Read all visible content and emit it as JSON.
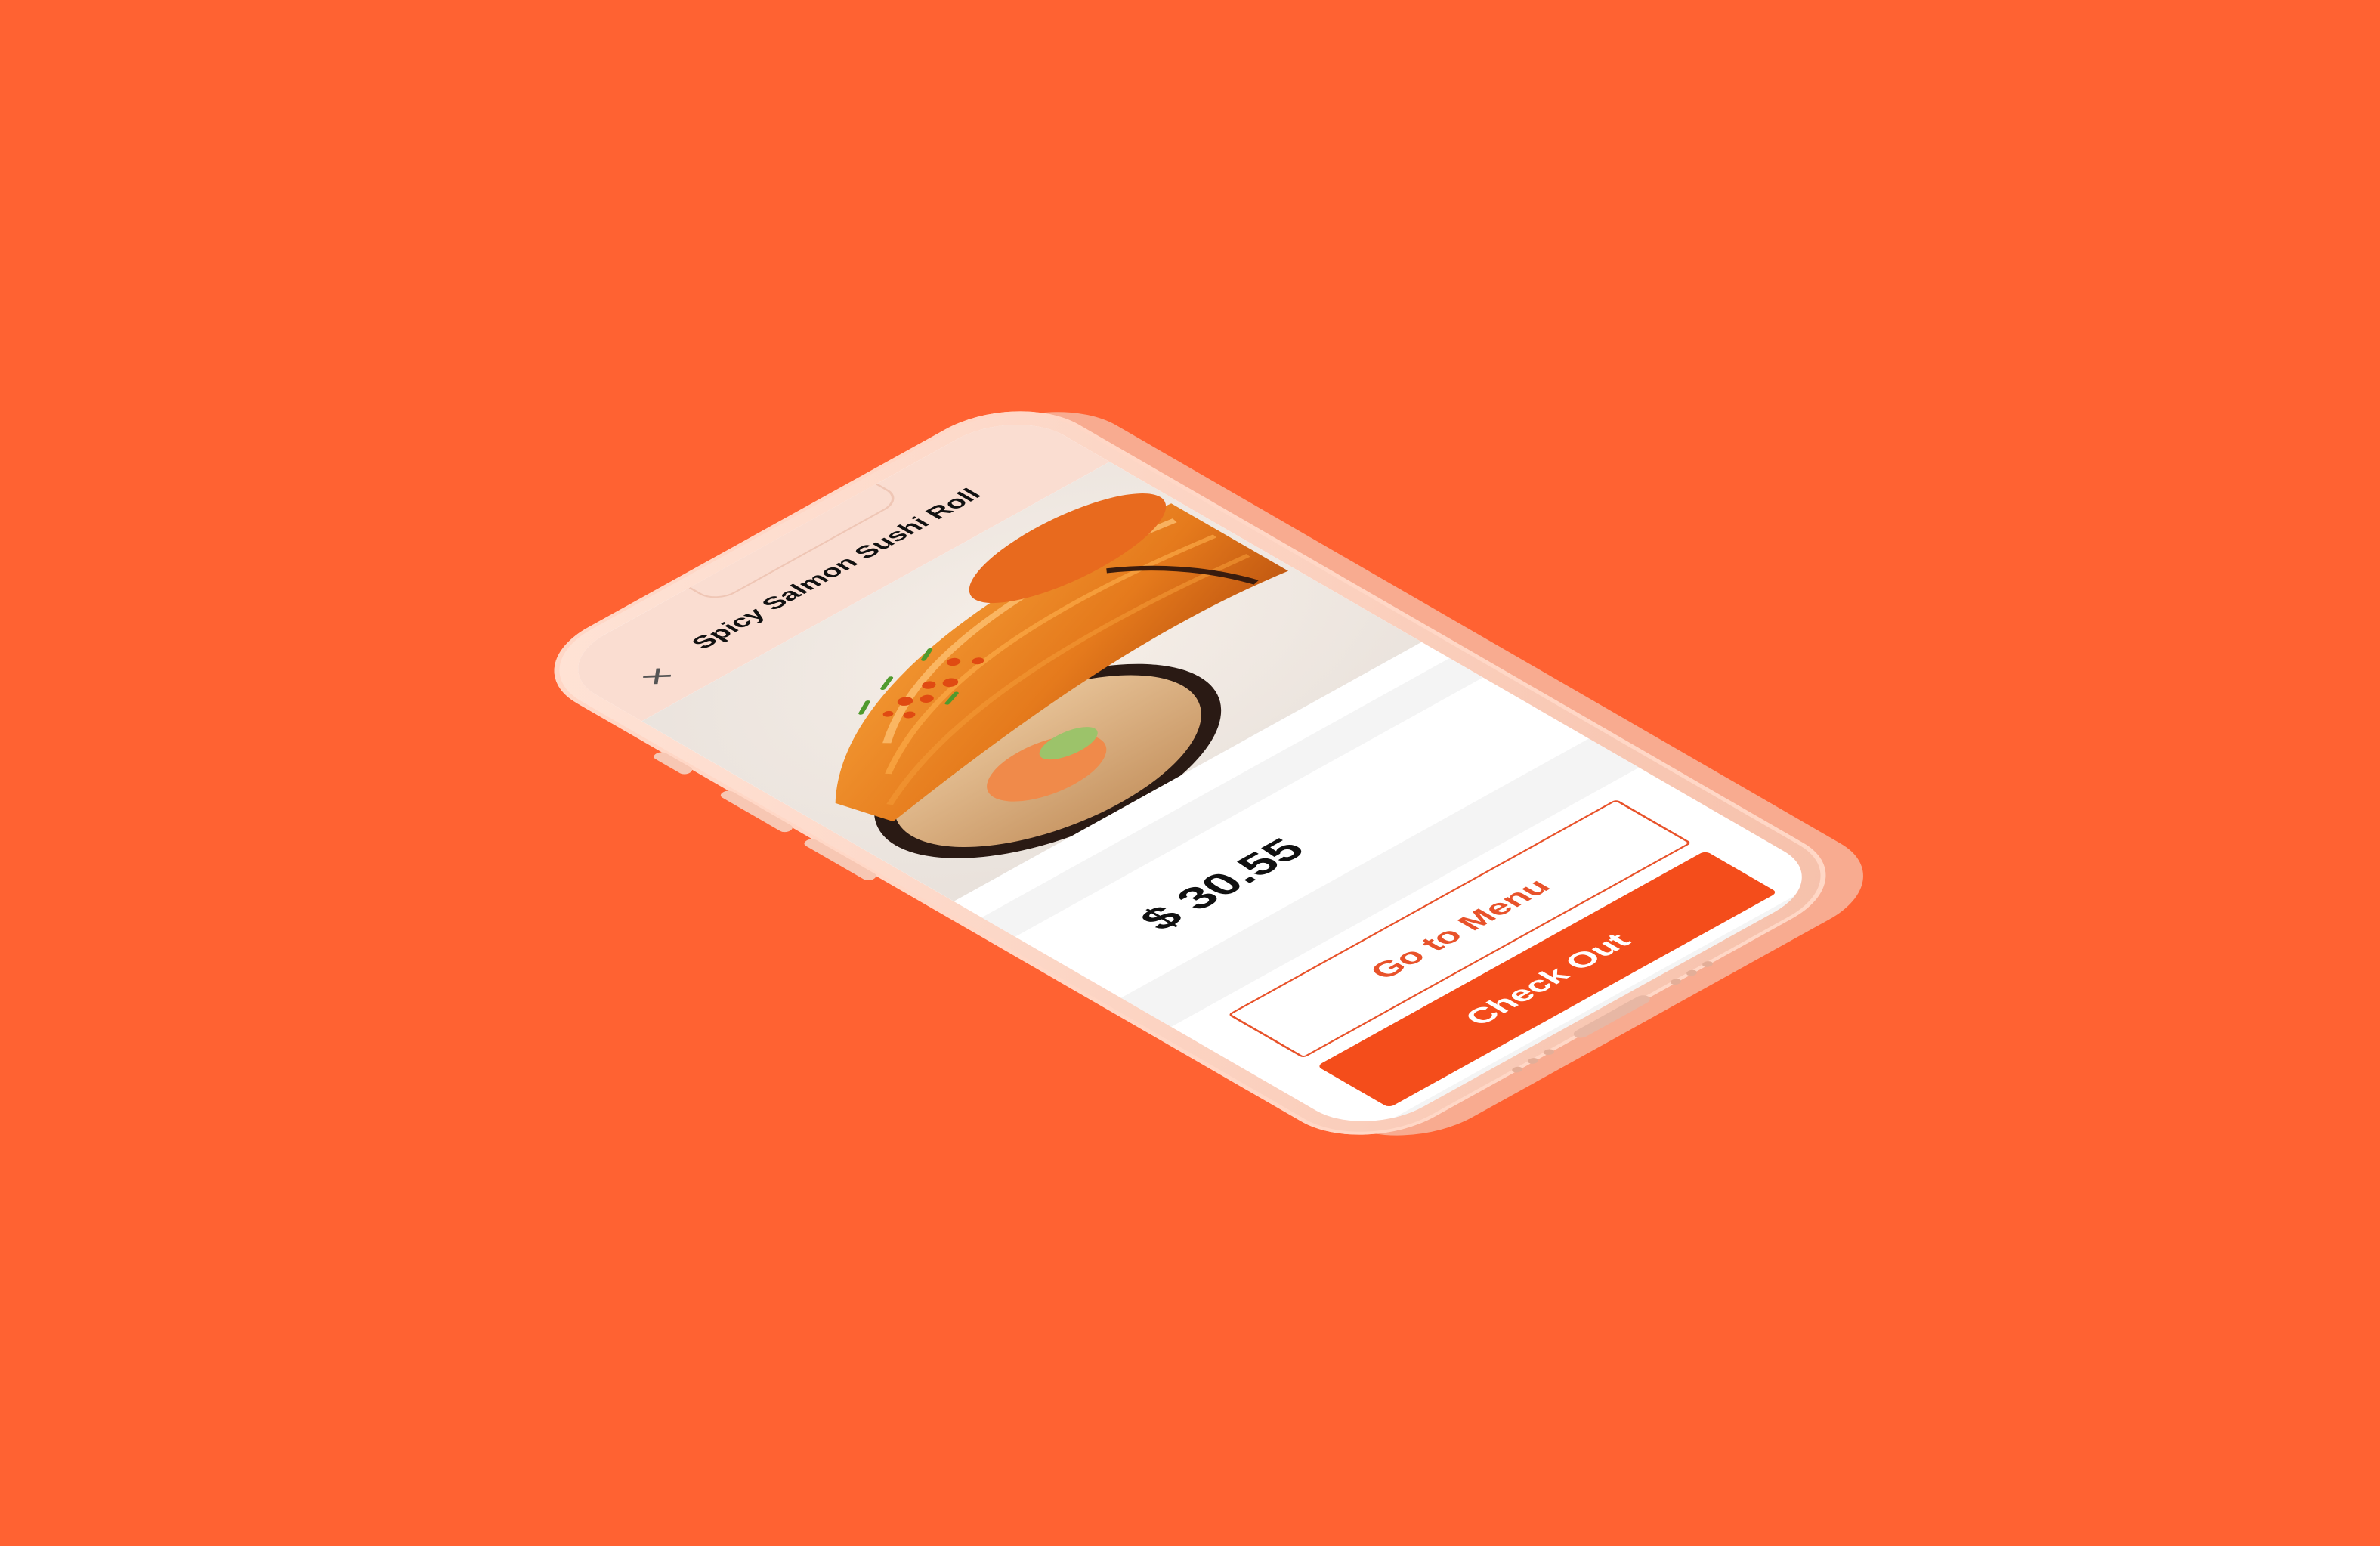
{
  "header": {
    "title": "Spicy Salmon Sushi Roll",
    "close_icon": "close-icon"
  },
  "product": {
    "image": "sushi-roll-photo",
    "price": "$ 30.55"
  },
  "actions": {
    "menu_label": "Go to Menu",
    "checkout_label": "Check Out"
  },
  "colors": {
    "background": "#FF6232",
    "accent": "#F44D1B",
    "phone_shell": "#FBD0BE"
  }
}
